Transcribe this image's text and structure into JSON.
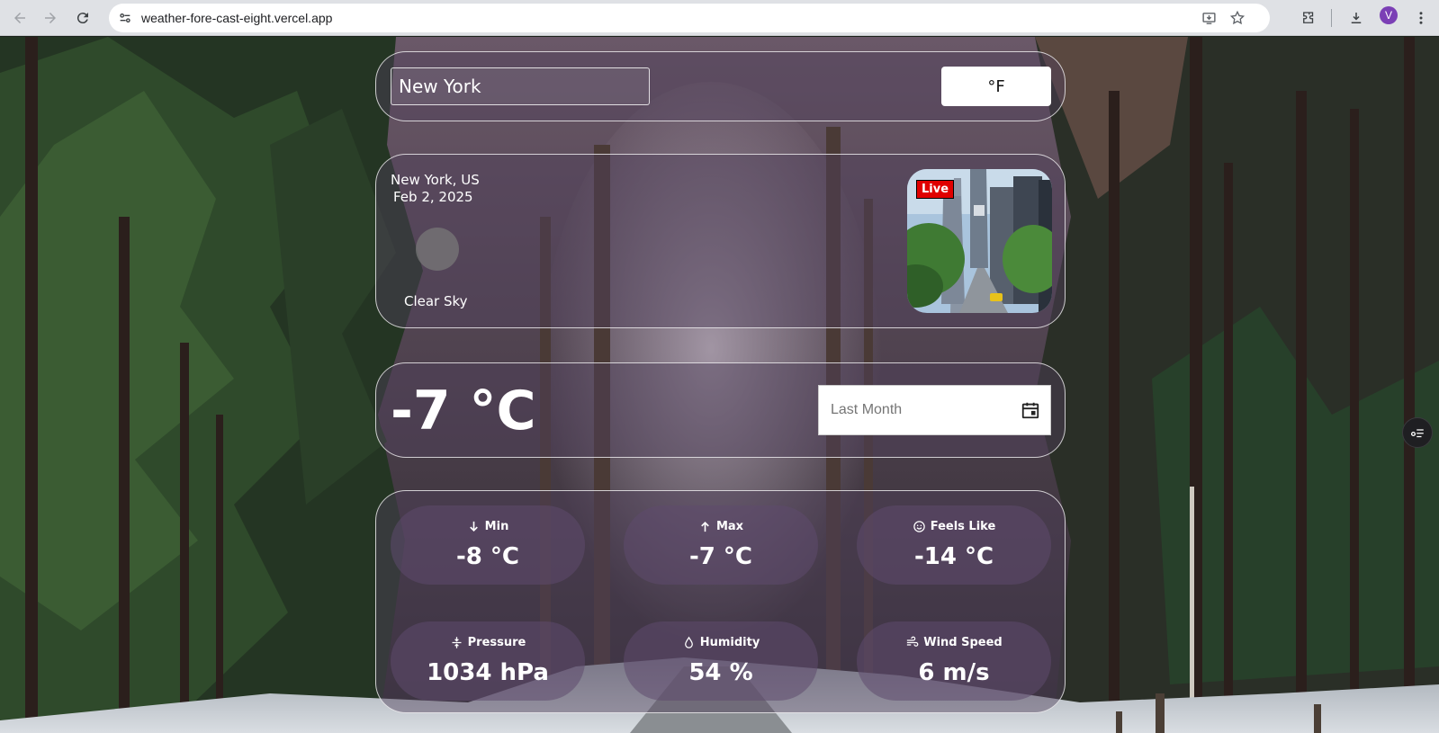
{
  "browser": {
    "url": "weather-fore-cast-eight.vercel.app",
    "profile_initial": "V",
    "icons": [
      "back-icon",
      "forward-icon",
      "reload-icon",
      "site-info-icon",
      "install-app-icon",
      "bookmark-star-icon",
      "extensions-icon",
      "downloads-icon",
      "kebab-menu-icon"
    ]
  },
  "search": {
    "city_value": "New York",
    "unit_toggle_label": "°F"
  },
  "location": {
    "name": "New York, US",
    "date": "Feb 2, 2025",
    "description": "Clear Sky",
    "live_label": "Live"
  },
  "current": {
    "temperature": "-7 °C",
    "history_placeholder": "Last Month"
  },
  "details": [
    {
      "label": "Min",
      "value": "-8 °C",
      "icon": "arrow-down-icon"
    },
    {
      "label": "Max",
      "value": "-7 °C",
      "icon": "arrow-up-icon"
    },
    {
      "label": "Feels Like",
      "value": "-14 °C",
      "icon": "smile-icon"
    },
    {
      "label": "Pressure",
      "value": "1034 hPa",
      "icon": "pressure-icon"
    },
    {
      "label": "Humidity",
      "value": "54 %",
      "icon": "droplet-icon"
    },
    {
      "label": "Wind Speed",
      "value": "6 m/s",
      "icon": "wind-icon"
    }
  ],
  "colors": {
    "live_badge": "#e00000",
    "card_bg": "#50405c",
    "accent_profile": "#7b3fb5"
  }
}
